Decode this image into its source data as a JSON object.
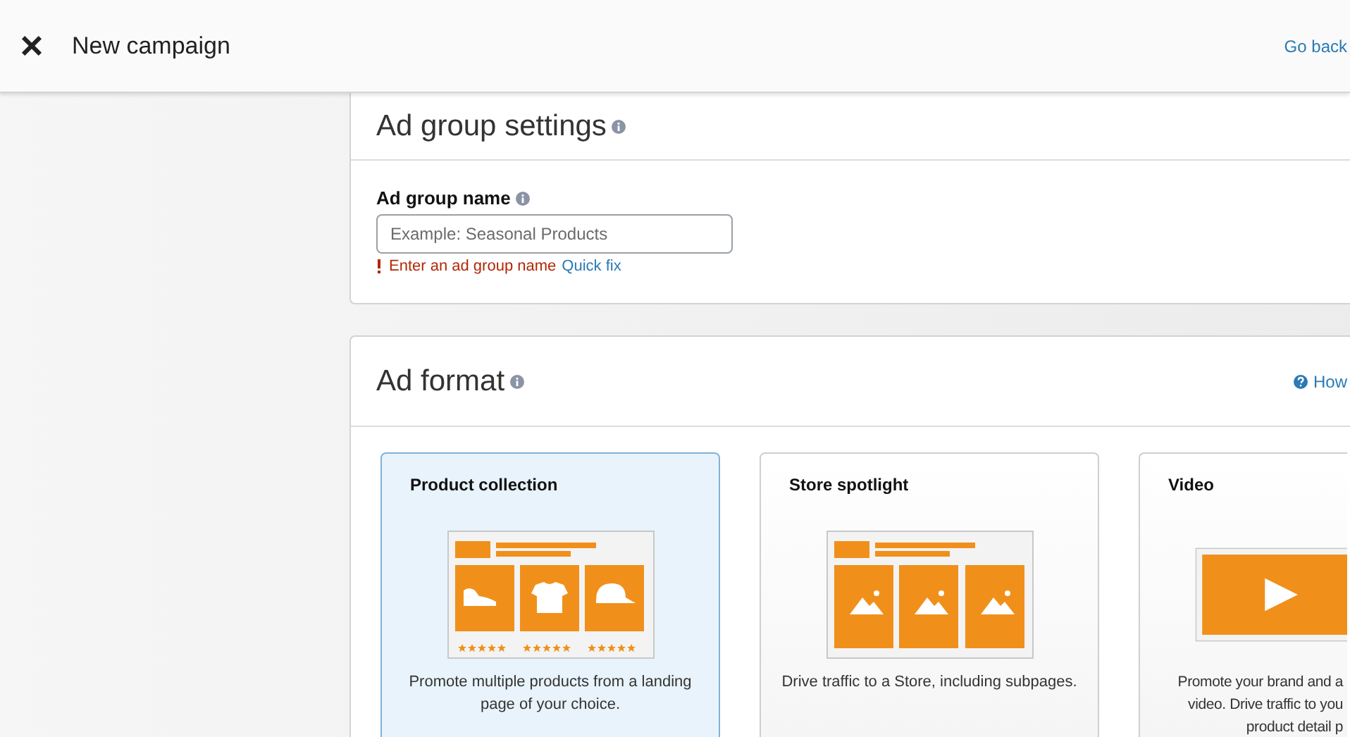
{
  "header": {
    "title": "New campaign",
    "back_link": "Go back"
  },
  "ad_group_settings": {
    "title": "Ad group settings",
    "field": {
      "label": "Ad group name",
      "placeholder": "Example: Seasonal Products",
      "error": "Enter an ad group name",
      "fix_link": "Quick fix"
    }
  },
  "ad_format": {
    "title": "Ad format",
    "help_link": "How",
    "formats": [
      {
        "title": "Product collection",
        "kind": "products",
        "selected": true,
        "description": [
          "Promote multiple products from a landing page of your choice."
        ]
      },
      {
        "title": "Store spotlight",
        "kind": "images",
        "selected": false,
        "description": [
          "Drive traffic to a Store, including subpages."
        ]
      },
      {
        "title": "Video",
        "kind": "video",
        "selected": false,
        "description": [
          "Promote your brand and a",
          "video. Drive traffic to you",
          "product detail p"
        ]
      }
    ]
  }
}
